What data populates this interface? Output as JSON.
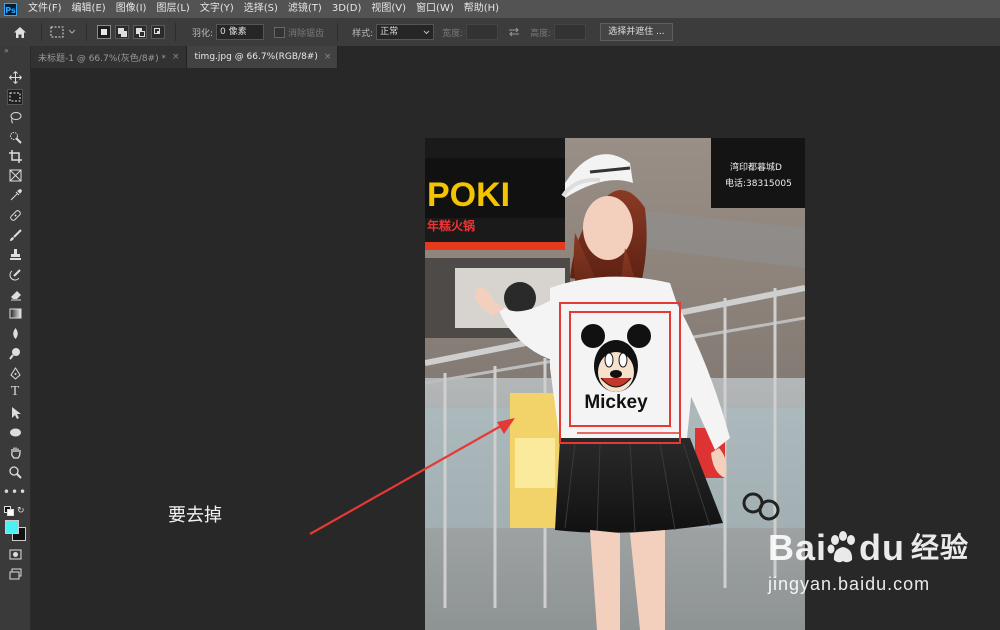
{
  "app": {
    "logo_text": "Ps"
  },
  "menu": [
    "文件(F)",
    "编辑(E)",
    "图像(I)",
    "图层(L)",
    "文字(Y)",
    "选择(S)",
    "滤镜(T)",
    "3D(D)",
    "视图(V)",
    "窗口(W)",
    "帮助(H)"
  ],
  "options": {
    "feather_label": "羽化:",
    "feather_value": "0 像素",
    "antialias_label": "消除锯齿",
    "style_label": "样式:",
    "style_value": "正常",
    "width_label": "宽度:",
    "height_label": "高度:",
    "select_mask_label": "选择并遮住 ..."
  },
  "tabs": [
    {
      "label": "未标题-1 @ 66.7%(灰色/8#) *",
      "close": "×"
    },
    {
      "label": "timg.jpg @ 66.7%(RGB/8#)",
      "close": "×"
    }
  ],
  "annotation": {
    "text": "要去掉"
  },
  "photo": {
    "shirt_text": "Mickey",
    "sign_left": "POKI",
    "sign_left_sub": "年糕火锅",
    "sign_right_1": "湾印都暮城D",
    "sign_right_2": "电话:38315005"
  },
  "watermark": {
    "brand_a": "Bai",
    "brand_b": "du",
    "brand_cn": "经验",
    "url": "jingyan.baidu.com"
  },
  "colors": {
    "foreground": "#4af0f2",
    "background": "#111111",
    "selection_red": "#e53935",
    "arrow_red": "#e53935",
    "ps_accent": "#31a8ff"
  }
}
